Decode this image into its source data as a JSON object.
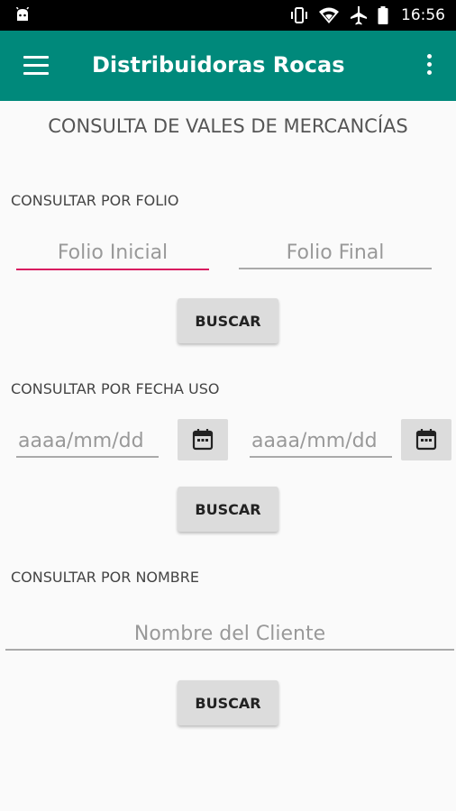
{
  "status_bar": {
    "time": "16:56"
  },
  "app_bar": {
    "title": "Distribuidoras Rocas"
  },
  "page_title": "CONSULTA DE VALES DE MERCANCÍAS",
  "section_folio": {
    "label": "CONSULTAR POR FOLIO",
    "folio_inicial_placeholder": "Folio Inicial",
    "folio_final_placeholder": "Folio Final",
    "button": "BUSCAR"
  },
  "section_fecha": {
    "label": "CONSULTAR POR FECHA USO",
    "fecha_inicial_placeholder": "aaaa/mm/dd",
    "fecha_final_placeholder": "aaaa/mm/dd",
    "button": "BUSCAR"
  },
  "section_nombre": {
    "label": "CONSULTAR POR NOMBRE",
    "cliente_placeholder": "Nombre del Cliente",
    "button": "BUSCAR"
  },
  "colors": {
    "primary": "#00897b",
    "accent": "#d81b60"
  }
}
